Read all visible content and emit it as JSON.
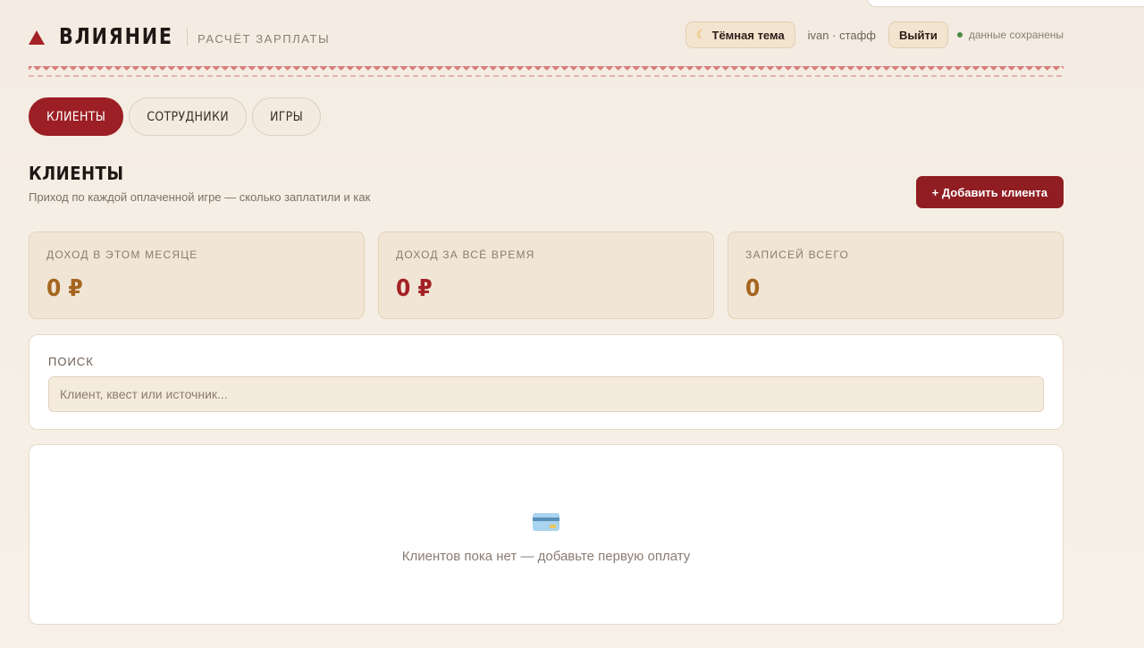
{
  "header": {
    "brand_name": "ВЛИЯНИЕ",
    "brand_sub": "РАСЧЁТ ЗАРПЛАТЫ",
    "theme_button": "Тёмная тема",
    "user": "ivan · стафф",
    "logout_button": "Выйти",
    "save_status": "данные сохранены"
  },
  "tabs": [
    {
      "label": "КЛИЕНТЫ",
      "active": true
    },
    {
      "label": "СОТРУДНИКИ",
      "active": false
    },
    {
      "label": "ИГРЫ",
      "active": false
    }
  ],
  "section": {
    "title": "КЛИЕНТЫ",
    "subtitle": "Приход по каждой оплаченной игре — сколько заплатили и как",
    "add_button": "+ Добавить клиента"
  },
  "stats": [
    {
      "label": "ДОХОД В ЭТОМ МЕСЯЦЕ",
      "value": "0 ₽",
      "color": "#a5651f"
    },
    {
      "label": "ДОХОД ЗА ВСЁ ВРЕМЯ",
      "value": "0 ₽",
      "color": "#a32226"
    },
    {
      "label": "ЗАПИСЕЙ ВСЕГО",
      "value": "0",
      "color": "#a5651f"
    }
  ],
  "search": {
    "label": "ПОИСК",
    "placeholder": "Клиент, квест или источник..."
  },
  "empty_state": {
    "icon": "credit-card-icon",
    "text": "Клиентов пока нет — добавьте первую оплату"
  },
  "colors": {
    "accent": "#9b1f24",
    "background": "#f5eee4"
  }
}
